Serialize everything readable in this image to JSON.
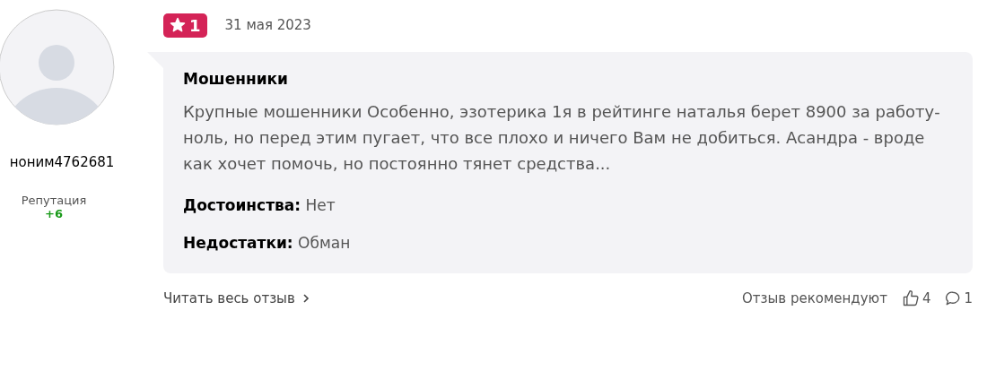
{
  "author": {
    "name": "ноним4762681",
    "reputation_label": "Репутация",
    "reputation": "+6"
  },
  "review": {
    "rating": "1",
    "date": "31 мая 2023",
    "title": "Мошенники",
    "text": "Крупные мошенники Особенно, эзотерика 1я в рейтинге наталья берет 8900 за работу- ноль, но перед этим пугает, что все плохо и ничего Вам не добиться. Асандра - вроде как хочет помочь, но постоянно тянет средства...",
    "pros_label": "Достоинства:",
    "pros": "Нет",
    "cons_label": "Недостатки:",
    "cons": "Обман"
  },
  "footer": {
    "read_more": "Читать весь отзыв",
    "recommend": "Отзыв рекомендуют",
    "likes": "4",
    "comments": "1"
  }
}
